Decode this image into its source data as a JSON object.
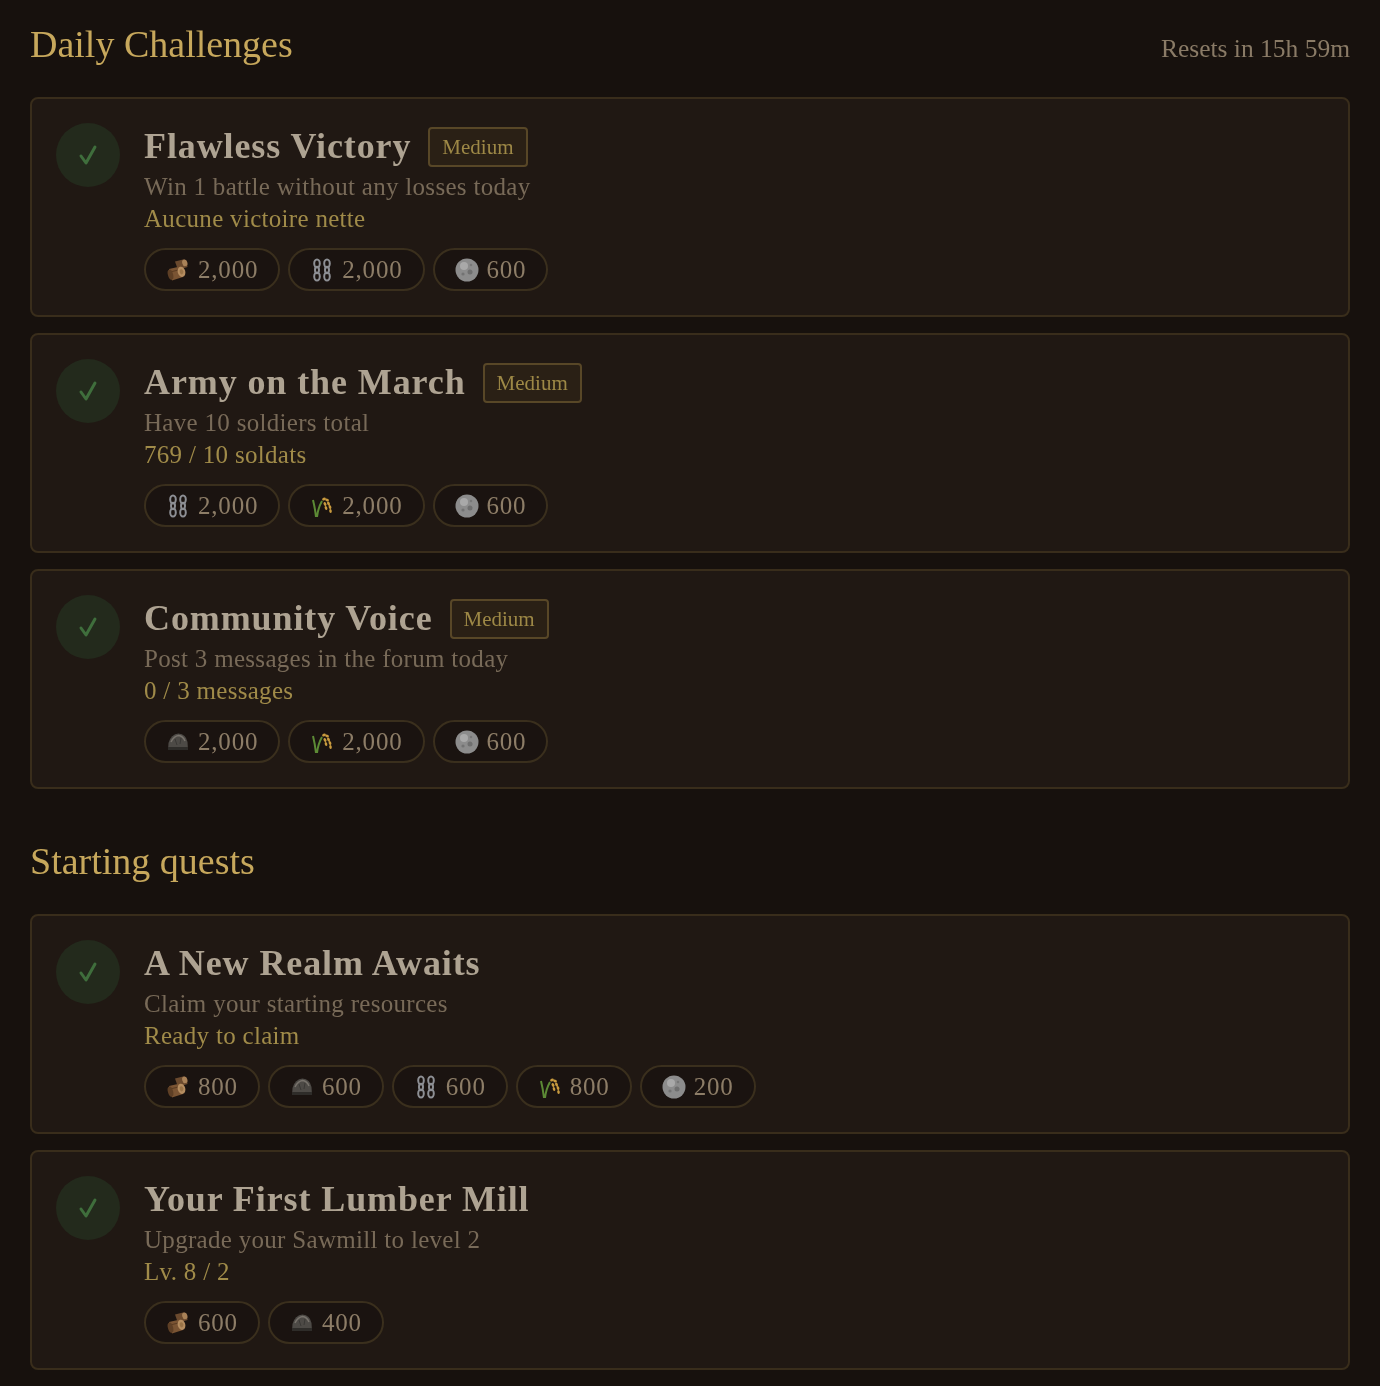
{
  "sections": [
    {
      "title": "Daily Challenges",
      "timer": "Resets in 15h 59m",
      "quests": [
        {
          "title": "Flawless Victory",
          "difficulty": "Medium",
          "description": "Win 1 battle without any losses today",
          "detail": "Aucune victoire nette",
          "completed": true,
          "rewards": [
            {
              "kind": "wood",
              "amount": "2,000"
            },
            {
              "kind": "iron",
              "amount": "2,000"
            },
            {
              "kind": "silver",
              "amount": "600"
            }
          ]
        },
        {
          "title": "Army on the March",
          "difficulty": "Medium",
          "description": "Have 10 soldiers total",
          "detail": "769 / 10 soldats",
          "completed": true,
          "rewards": [
            {
              "kind": "iron",
              "amount": "2,000"
            },
            {
              "kind": "grain",
              "amount": "2,000"
            },
            {
              "kind": "silver",
              "amount": "600"
            }
          ]
        },
        {
          "title": "Community Voice",
          "difficulty": "Medium",
          "description": "Post 3 messages in the forum today",
          "detail": "0 / 3 messages",
          "completed": true,
          "rewards": [
            {
              "kind": "stone",
              "amount": "2,000"
            },
            {
              "kind": "grain",
              "amount": "2,000"
            },
            {
              "kind": "silver",
              "amount": "600"
            }
          ]
        }
      ]
    },
    {
      "title": "Starting quests",
      "quests": [
        {
          "title": "A New Realm Awaits",
          "description": "Claim your starting resources",
          "detail": "Ready to claim",
          "completed": true,
          "rewards": [
            {
              "kind": "wood",
              "amount": "800"
            },
            {
              "kind": "stone",
              "amount": "600"
            },
            {
              "kind": "iron",
              "amount": "600"
            },
            {
              "kind": "grain",
              "amount": "800"
            },
            {
              "kind": "silver",
              "amount": "200"
            }
          ]
        },
        {
          "title": "Your First Lumber Mill",
          "description": "Upgrade your Sawmill to level 2",
          "detail": "Lv. 8 / 2",
          "completed": true,
          "rewards": [
            {
              "kind": "wood",
              "amount": "600"
            },
            {
              "kind": "stone",
              "amount": "400"
            }
          ]
        }
      ]
    }
  ]
}
